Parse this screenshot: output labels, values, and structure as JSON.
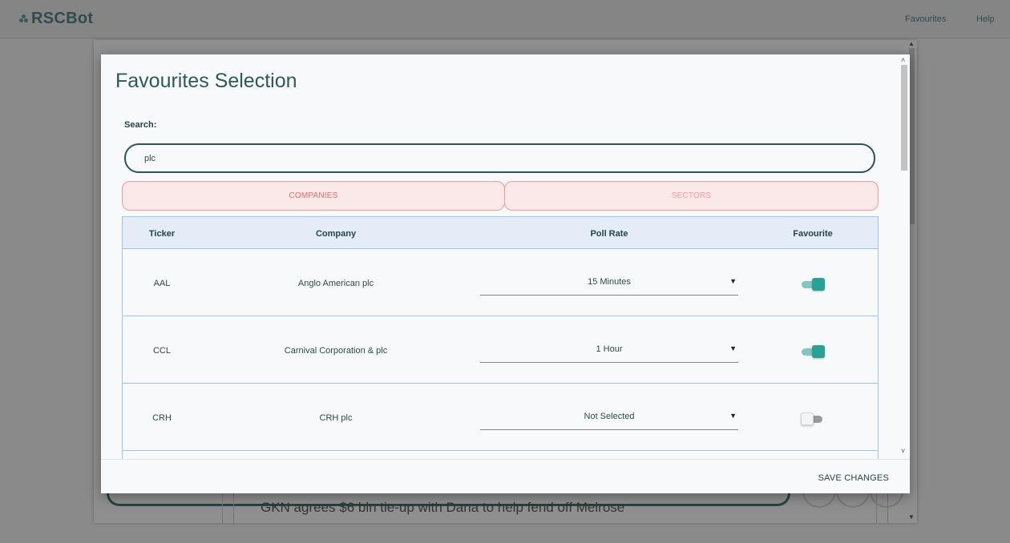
{
  "app": {
    "logo": "RSCBot",
    "nav": {
      "favourites": "Favourites",
      "help": "Help"
    }
  },
  "background": {
    "headline": "GKN agrees $6 bln tie-up with Dana to help fend off Melrose"
  },
  "modal": {
    "title": "Favourites Selection",
    "search_label": "Search:",
    "search_value": "plc",
    "tabs": {
      "companies": "COMPANIES",
      "sectors": "SECTORS"
    },
    "table": {
      "headers": {
        "ticker": "Ticker",
        "company": "Company",
        "poll_rate": "Poll Rate",
        "favourite": "Favourite"
      },
      "rows": [
        {
          "ticker": "AAL",
          "company": "Anglo American plc",
          "poll_rate": "15 Minutes",
          "favourite": true
        },
        {
          "ticker": "CCL",
          "company": "Carnival Corporation & plc",
          "poll_rate": "1 Hour",
          "favourite": true
        },
        {
          "ticker": "CRH",
          "company": "CRH plc",
          "poll_rate": "Not Selected",
          "favourite": false
        }
      ]
    },
    "save_label": "SAVE CHANGES"
  },
  "colors": {
    "accent": "#2aa197",
    "title": "#2d5a58",
    "tab_border": "#f09a9a",
    "table_header_bg": "#e3ecf7"
  },
  "icons": {
    "dropdown": "caret-down-icon",
    "scroll_up": "chevron-up-icon",
    "scroll_down": "chevron-down-icon"
  }
}
